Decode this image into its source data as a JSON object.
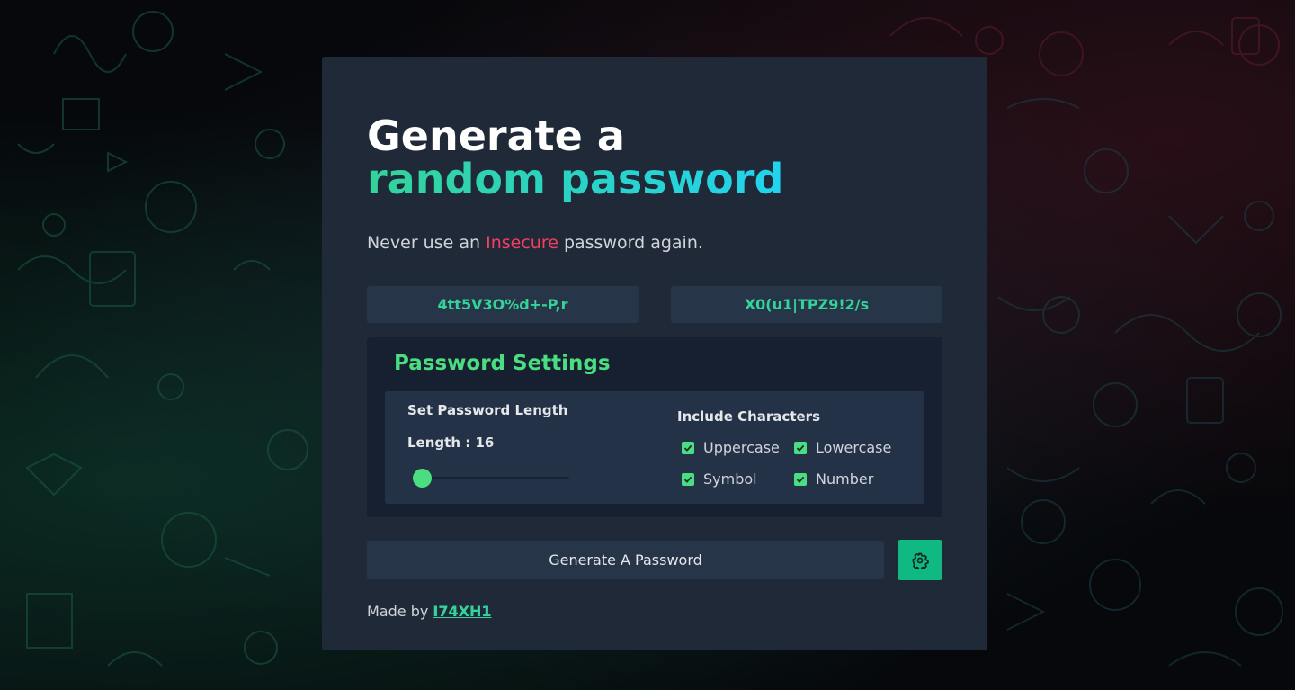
{
  "hero": {
    "title_line1": "Generate a",
    "title_line2": "random password",
    "subtitle_before": "Never use an ",
    "subtitle_highlight": "Insecure",
    "subtitle_after": " password again."
  },
  "passwords": [
    "4tt5V3O%d+-P,r",
    "X0(u1|TPZ9!2/s"
  ],
  "settings": {
    "title": "Password Settings",
    "length_label": "Set Password Length",
    "length_value_text": "Length : 16",
    "length_value": 16,
    "include_label": "Include Characters",
    "options": [
      {
        "label": "Uppercase",
        "checked": true
      },
      {
        "label": "Lowercase",
        "checked": true
      },
      {
        "label": "Symbol",
        "checked": true
      },
      {
        "label": "Number",
        "checked": true
      }
    ]
  },
  "actions": {
    "generate_label": "Generate A Password",
    "settings_icon": "gear-icon"
  },
  "footer": {
    "made_by": "Made by",
    "author": "I74XH1"
  },
  "colors": {
    "accent_green": "#4ade80",
    "accent_teal": "#22d3ee",
    "insecure_red": "#f43f5e",
    "card_bg": "#1f2937"
  }
}
